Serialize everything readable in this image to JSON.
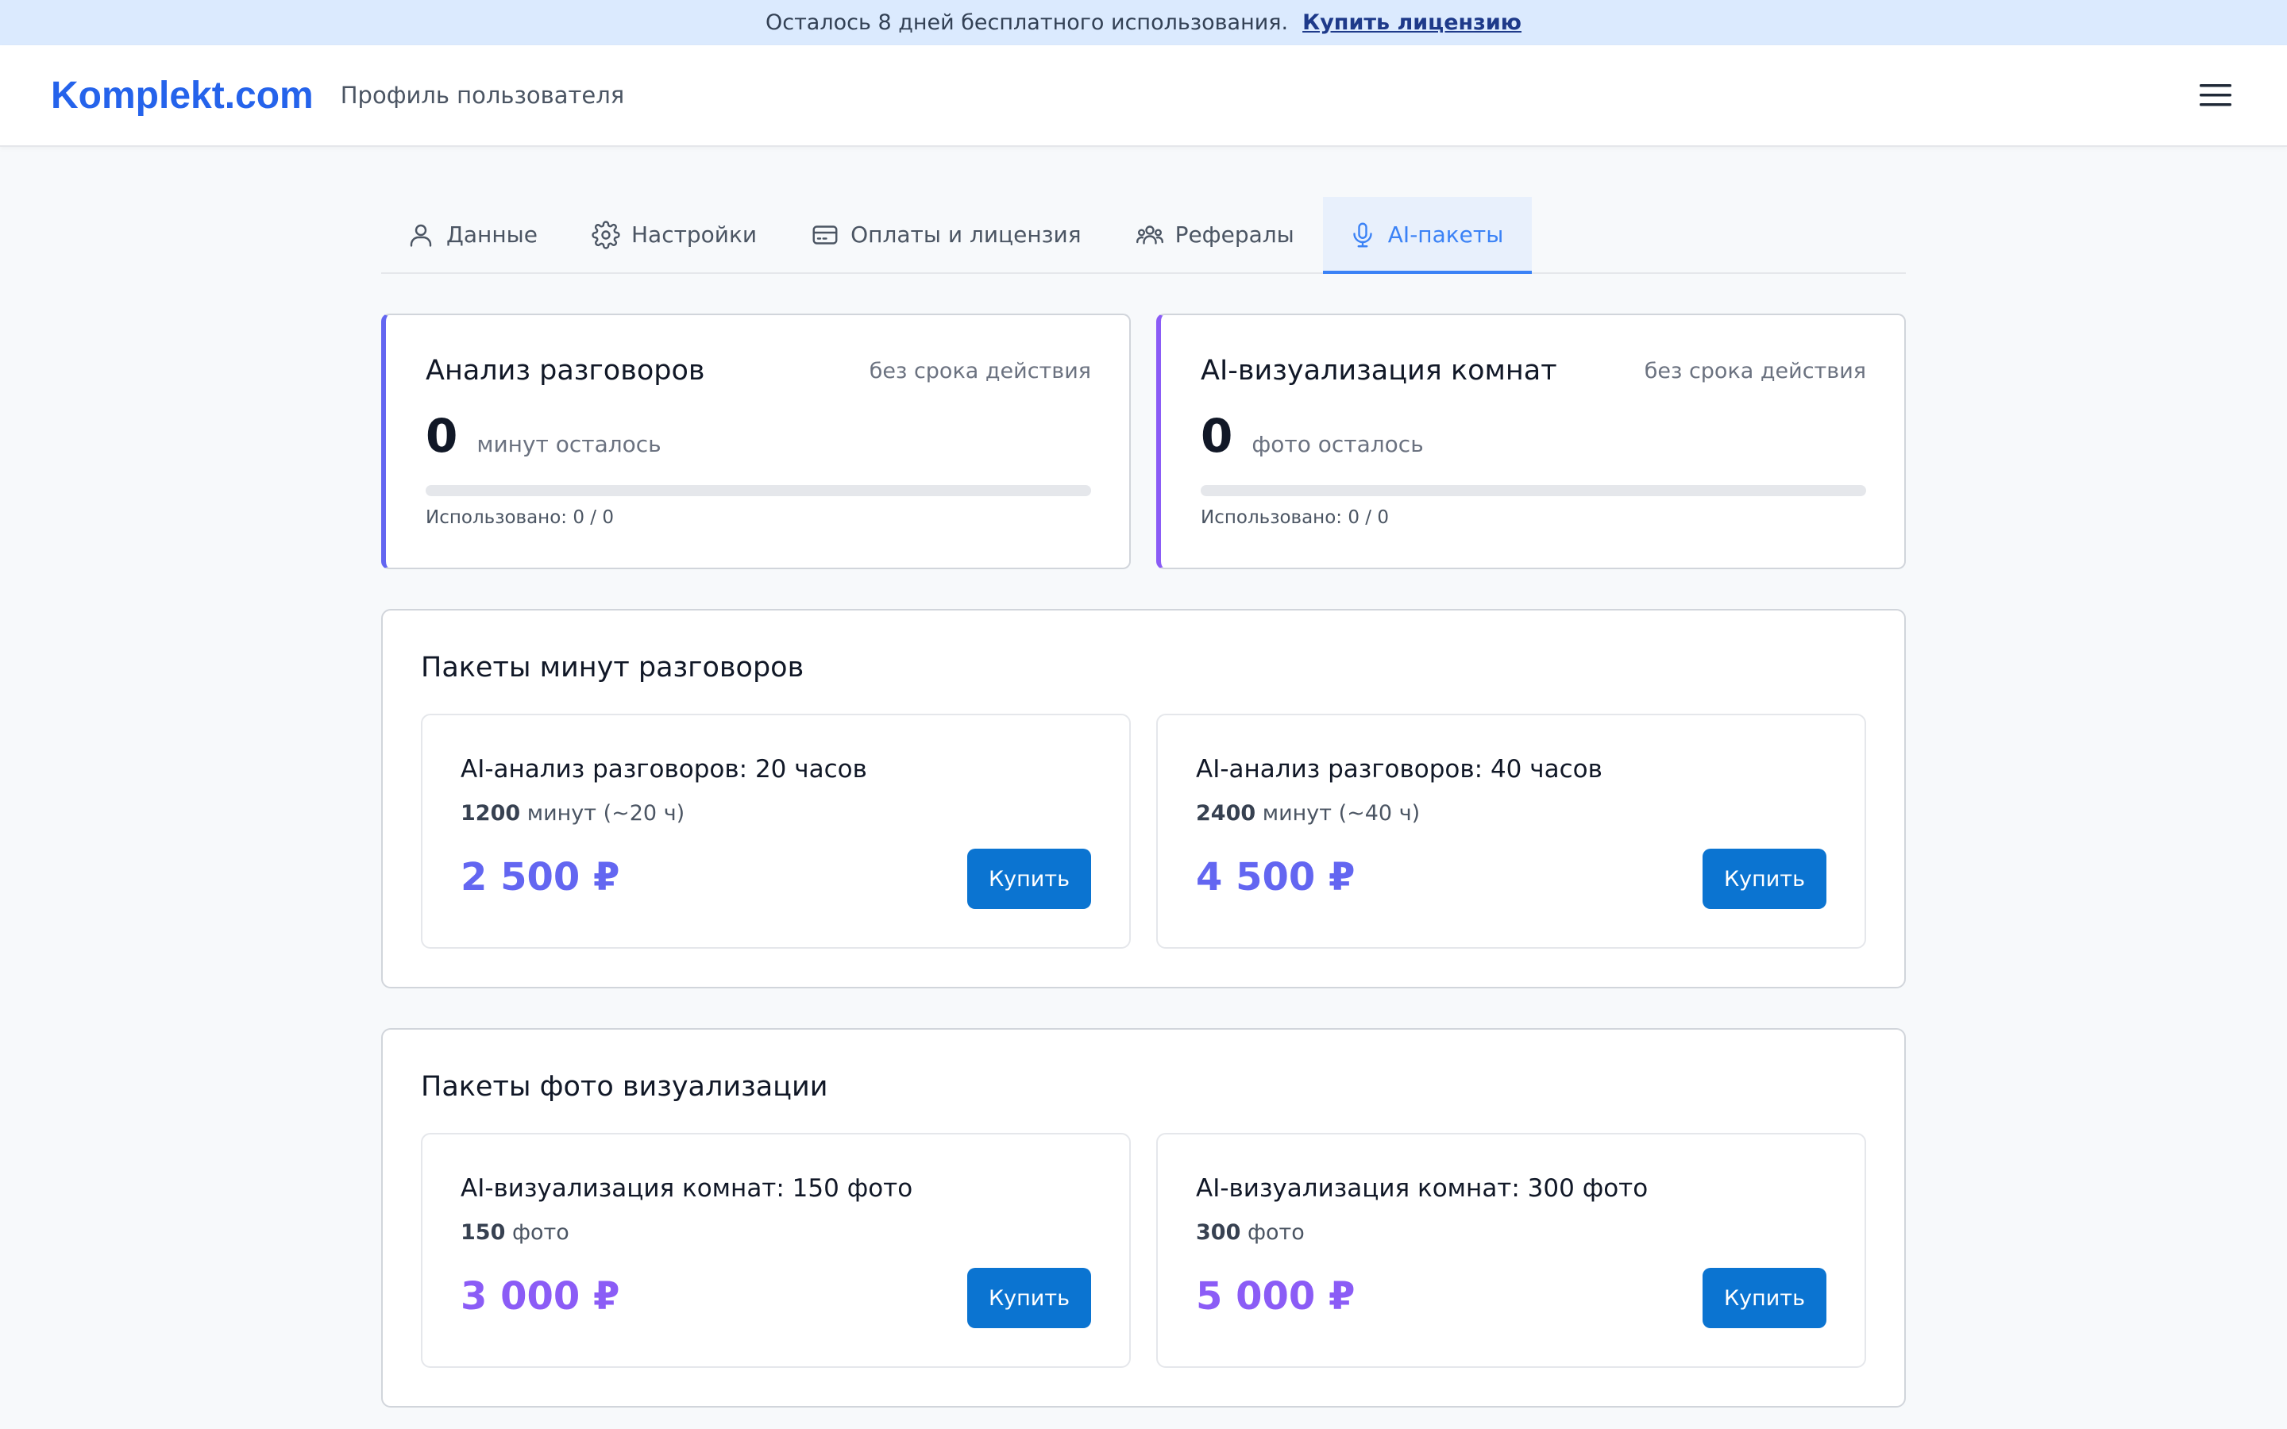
{
  "banner": {
    "text": "Осталось 8 дней бесплатного использования.",
    "link": "Купить лицензию"
  },
  "header": {
    "brand": "Komplekt.com",
    "subtitle": "Профиль пользователя"
  },
  "tabs": [
    {
      "label": "Данные",
      "icon": "user-icon",
      "active": false
    },
    {
      "label": "Настройки",
      "icon": "gear-icon",
      "active": false
    },
    {
      "label": "Оплаты и лицензия",
      "icon": "credit-card-icon",
      "active": false
    },
    {
      "label": "Рефералы",
      "icon": "users-icon",
      "active": false
    },
    {
      "label": "AI-пакеты",
      "icon": "microphone-icon",
      "active": true
    }
  ],
  "usage": [
    {
      "title": "Анализ разговоров",
      "validity": "без срока действия",
      "count": "0",
      "unit": "минут осталось",
      "used": "Использовано: 0 / 0",
      "progress": 0
    },
    {
      "title": "AI-визуализация комнат",
      "validity": "без срока действия",
      "count": "0",
      "unit": "фото осталось",
      "used": "Использовано: 0 / 0",
      "progress": 0
    }
  ],
  "sections": [
    {
      "title": "Пакеты минут разговоров",
      "packages": [
        {
          "title": "AI-анализ разговоров: 20 часов",
          "amount": "1200",
          "detail": " минут (~20 ч)",
          "price": "2 500 ₽",
          "button": "Купить"
        },
        {
          "title": "AI-анализ разговоров: 40 часов",
          "amount": "2400",
          "detail": " минут (~40 ч)",
          "price": "4 500 ₽",
          "button": "Купить"
        }
      ]
    },
    {
      "title": "Пакеты фото визуализации",
      "packages": [
        {
          "title": "AI-визуализация комнат: 150 фото",
          "amount": "150",
          "detail": " фото",
          "price": "3 000 ₽",
          "button": "Купить"
        },
        {
          "title": "AI-визуализация комнат: 300 фото",
          "amount": "300",
          "detail": " фото",
          "price": "5 000 ₽",
          "button": "Купить"
        }
      ]
    }
  ],
  "colors": {
    "brand": "#2563eb",
    "accent_minutes": "#6366f1",
    "accent_photos": "#8b5cf6",
    "button": "#0b74d1",
    "active_tab": "#3b82f6"
  }
}
